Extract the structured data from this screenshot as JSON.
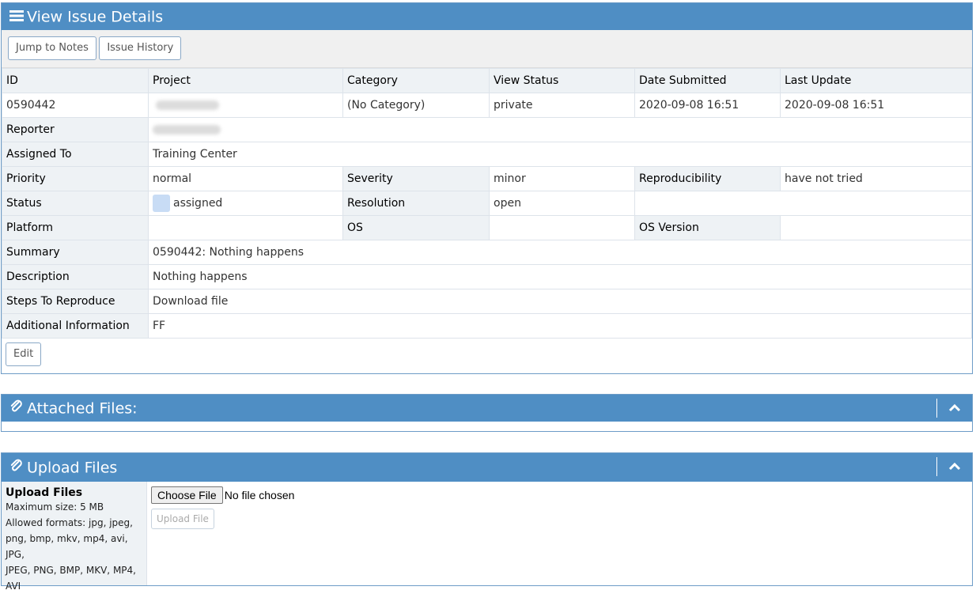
{
  "issue_panel": {
    "title": "View Issue Details",
    "buttons": {
      "jump_to_notes": "Jump to Notes",
      "issue_history": "Issue History"
    },
    "header_row": [
      "ID",
      "Project",
      "Category",
      "View Status",
      "Date Submitted",
      "Last Update"
    ],
    "value_row": {
      "id": "0590442",
      "project": "",
      "category": "(No Category)",
      "view_status": "private",
      "date_submitted": "2020-09-08 16:51",
      "last_update": "2020-09-08 16:51"
    },
    "reporter": {
      "label": "Reporter",
      "value": ""
    },
    "assigned_to": {
      "label": "Assigned To",
      "value": "Training Center"
    },
    "priority": {
      "label": "Priority",
      "value": "normal"
    },
    "severity": {
      "label": "Severity",
      "value": "minor"
    },
    "reproducibility": {
      "label": "Reproducibility",
      "value": "have not tried"
    },
    "status": {
      "label": "Status",
      "value": "assigned",
      "color": "#c8dcf5"
    },
    "resolution": {
      "label": "Resolution",
      "value": "open"
    },
    "platform": {
      "label": "Platform",
      "value": ""
    },
    "os": {
      "label": "OS",
      "value": ""
    },
    "os_version": {
      "label": "OS Version",
      "value": ""
    },
    "summary": {
      "label": "Summary",
      "value": "0590442: Nothing happens"
    },
    "description": {
      "label": "Description",
      "value": "Nothing happens"
    },
    "steps": {
      "label": "Steps To Reproduce",
      "value": "Download file"
    },
    "additional": {
      "label": "Additional Information",
      "value": "FF"
    },
    "edit_label": "Edit",
    "icon": "menu-icon"
  },
  "attached_panel": {
    "title": "Attached Files:",
    "icon": "paperclip-icon"
  },
  "upload_panel": {
    "title": "Upload Files",
    "icon": "paperclip-icon",
    "label": "Upload Files",
    "max_size": "Maximum size: 5 MB",
    "allowed_lines": [
      "Allowed formats: jpg, jpeg,",
      "png, bmp, mkv, mp4, avi, JPG,",
      "JPEG, PNG, BMP, MKV, MP4,",
      "AVI"
    ],
    "choose_label": "Choose File",
    "no_file": "No file chosen",
    "upload_button": "Upload File"
  },
  "colors": {
    "header_bg": "#4f8ec4",
    "label_bg": "#eef2f5",
    "border": "#6d9cc7"
  }
}
